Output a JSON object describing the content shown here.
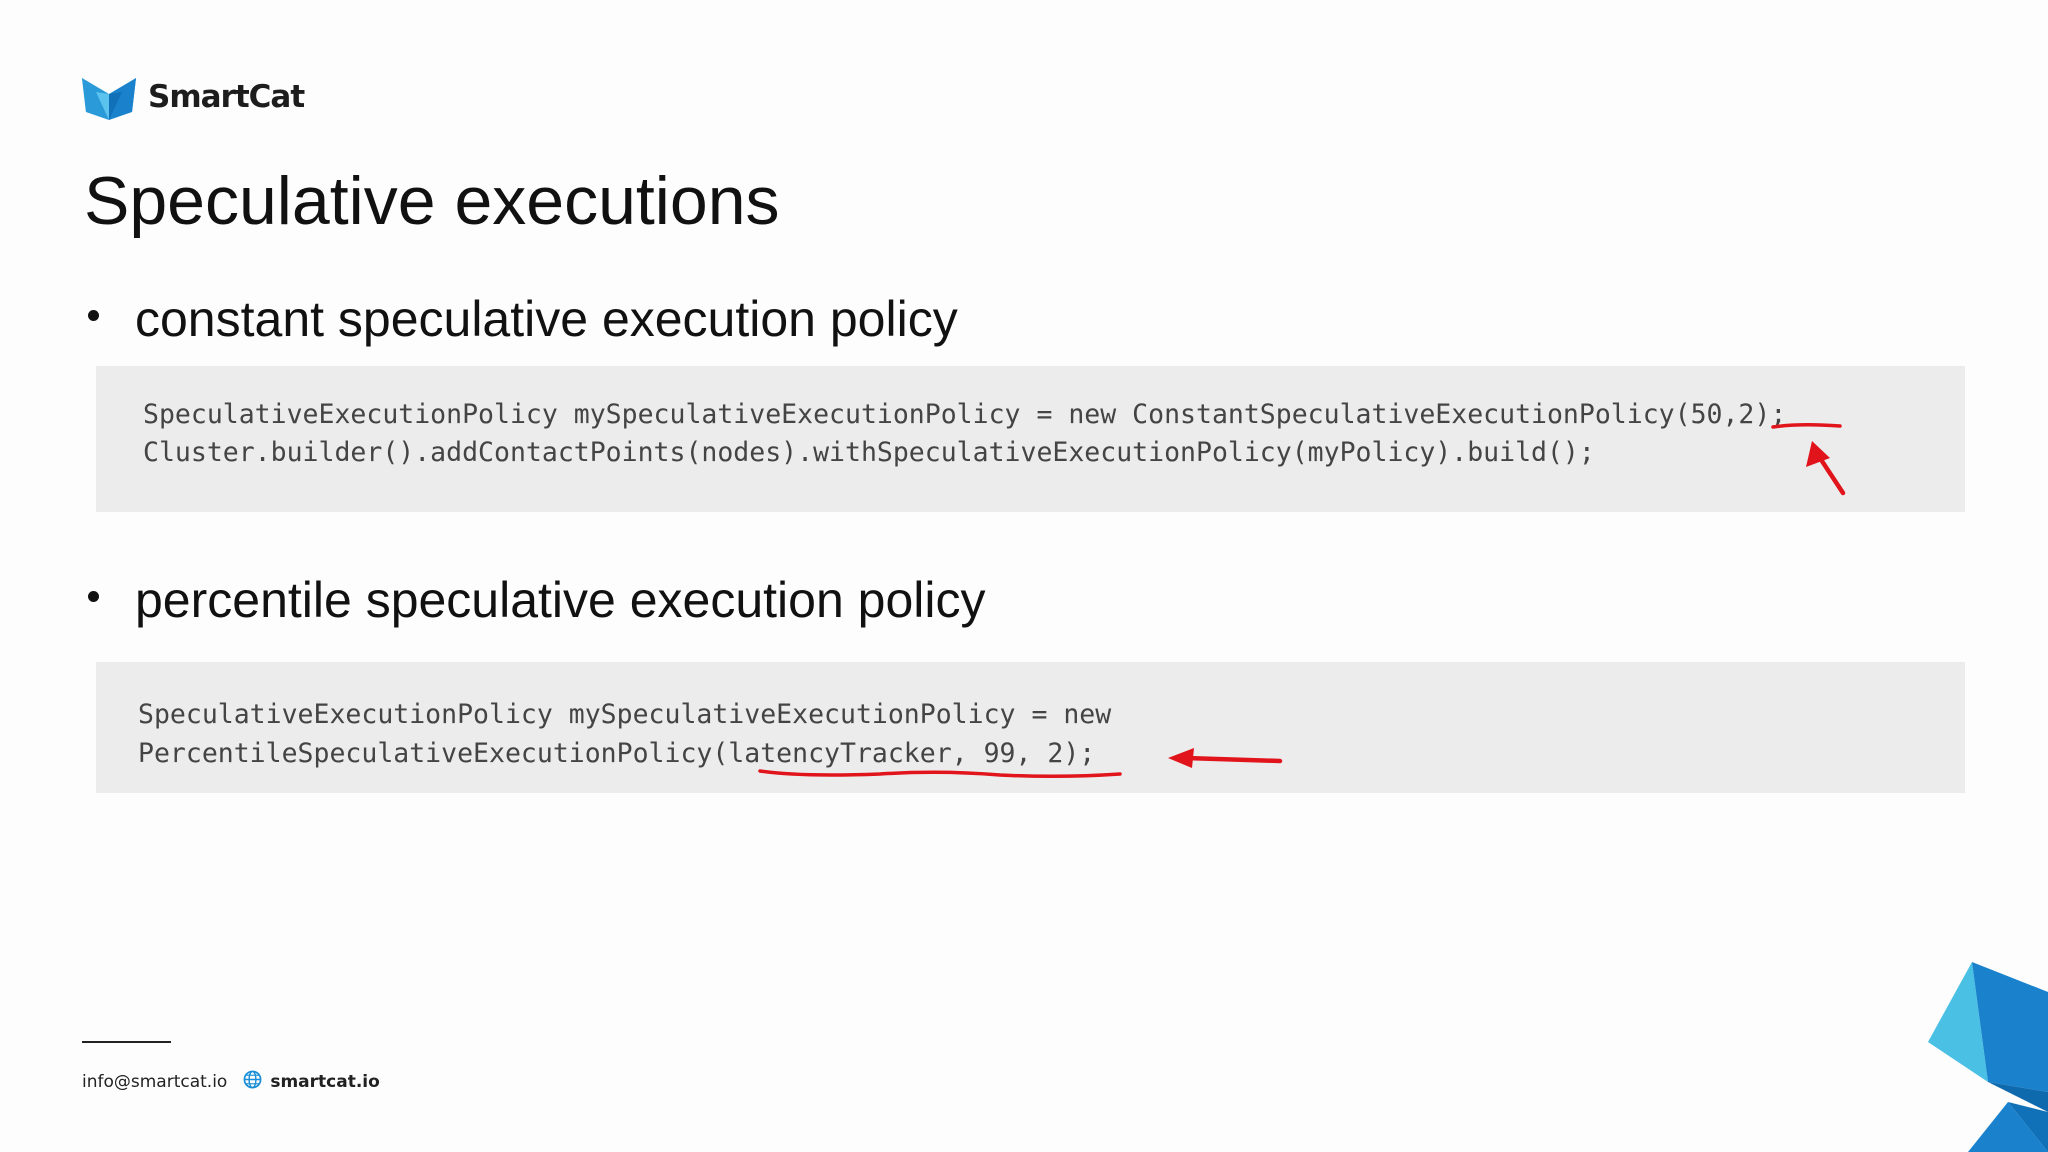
{
  "brand": {
    "name": "SmartCat",
    "logo_icon": "cat-head-icon",
    "accent": "#1a8ed6"
  },
  "slide": {
    "title": "Speculative executions",
    "sections": [
      {
        "bullet": "constant speculative execution policy",
        "code": [
          "SpeculativeExecutionPolicy mySpeculativeExecutionPolicy = new ConstantSpeculativeExecutionPolicy(50,2);",
          "Cluster.builder().addContactPoints(nodes).withSpeculativeExecutionPolicy(myPolicy).build();"
        ]
      },
      {
        "bullet": "percentile speculative execution policy",
        "code": [
          "SpeculativeExecutionPolicy mySpeculativeExecutionPolicy = new",
          "PercentileSpeculativeExecutionPolicy(latencyTracker, 99, 2);"
        ]
      }
    ],
    "annotation_color": "#e0141a"
  },
  "footer": {
    "email": "info@smartcat.io",
    "website": "smartcat.io",
    "website_icon": "globe-icon"
  }
}
